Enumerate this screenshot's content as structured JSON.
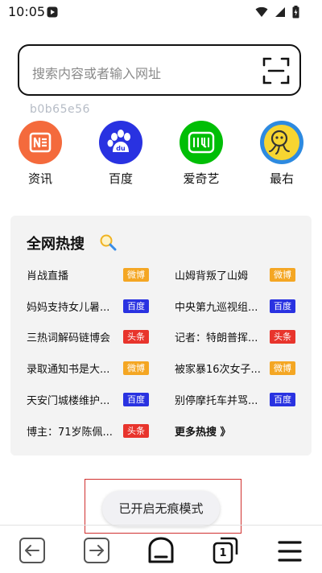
{
  "status_bar": {
    "time": "10:05",
    "icons": [
      "app-notification-icon",
      "wifi-icon",
      "cellular-signal-icon",
      "battery-charging-icon"
    ]
  },
  "search": {
    "placeholder": "搜索内容或者输入网址",
    "scan_icon": "scan-icon"
  },
  "build_id": "b0b65e56",
  "quick_links": [
    {
      "label": "资讯",
      "icon": "news-icon",
      "color": "#f46a3c"
    },
    {
      "label": "百度",
      "icon": "baidu-paw-icon",
      "color": "#2932e1"
    },
    {
      "label": "爱奇艺",
      "icon": "iqiyi-icon",
      "color": "#00be06"
    },
    {
      "label": "最右",
      "icon": "zuiyou-icon",
      "color": "#f7d531"
    }
  ],
  "hot_search": {
    "title": "全网热搜",
    "title_icon": "magnifier-icon",
    "items": [
      {
        "text": "肖战直播",
        "source": "微博",
        "badge_color": "#f4a623"
      },
      {
        "text": "山姆背叛了山姆",
        "source": "微博",
        "badge_color": "#f4a623"
      },
      {
        "text": "妈妈支持女儿暑...",
        "source": "百度",
        "badge_color": "#2932e1"
      },
      {
        "text": "中央第九巡视组...",
        "source": "百度",
        "badge_color": "#2932e1"
      },
      {
        "text": "三热词解码链博会",
        "source": "头条",
        "badge_color": "#e8342c"
      },
      {
        "text": "记者：特朗普挥...",
        "source": "头条",
        "badge_color": "#e8342c"
      },
      {
        "text": "录取通知书是大...",
        "source": "微博",
        "badge_color": "#f4a623"
      },
      {
        "text": "被家暴16次女子...",
        "source": "微博",
        "badge_color": "#f4a623"
      },
      {
        "text": "天安门城楼维护...",
        "source": "百度",
        "badge_color": "#2932e1"
      },
      {
        "text": "别停摩托车并骂...",
        "source": "百度",
        "badge_color": "#2932e1"
      },
      {
        "text": "博主：71岁陈佩...",
        "source": "头条",
        "badge_color": "#e8342c"
      }
    ],
    "more_label": "更多热搜 》"
  },
  "toast": {
    "message": "已开启无痕模式"
  },
  "bottom_nav": {
    "back_icon": "back-arrow-icon",
    "forward_icon": "forward-arrow-icon",
    "home_icon": "home-icon",
    "tabs_icon": "tabs-icon",
    "tab_count": "1",
    "menu_icon": "menu-icon"
  }
}
